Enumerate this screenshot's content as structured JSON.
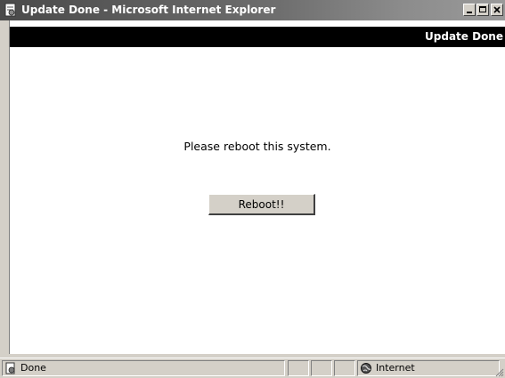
{
  "window": {
    "title": "Update Done - Microsoft Internet Explorer",
    "icon": "ie-page-icon",
    "controls": [
      "minimize-icon",
      "maximize-icon",
      "close-icon"
    ]
  },
  "page": {
    "header_title": "Update Done",
    "message": "Please reboot this system.",
    "reboot_label": "Reboot!!"
  },
  "statusbar": {
    "status_text": "Done",
    "status_icon": "page-done-icon",
    "zone_text": "Internet",
    "zone_icon": "globe-icon"
  },
  "colors": {
    "header_band": "#000000",
    "chrome": "#d4d0c8",
    "page_bg": "#ffffff"
  }
}
